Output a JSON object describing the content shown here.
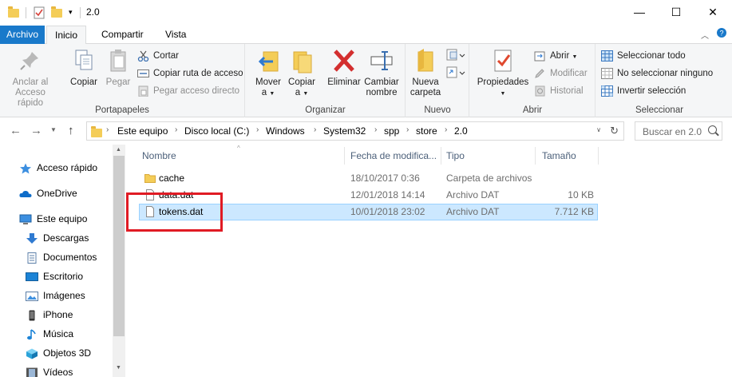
{
  "window": {
    "title": "2.0",
    "controls": {
      "minimize": "—",
      "maximize": "☐",
      "close": "✕"
    }
  },
  "ribbon_tabs": [
    {
      "label": "Archivo"
    },
    {
      "label": "Inicio"
    },
    {
      "label": "Compartir"
    },
    {
      "label": "Vista"
    }
  ],
  "ribbon": {
    "portapapeles": {
      "label": "Portapapeles",
      "pin": "Anclar al\nAcceso rápido",
      "pin_l1": "Anclar al",
      "pin_l2": "Acceso rápido",
      "copy": "Copiar",
      "paste": "Pegar",
      "cut": "Cortar",
      "copy_path": "Copiar ruta de acceso",
      "paste_shortcut": "Pegar acceso directo"
    },
    "organizar": {
      "label": "Organizar",
      "move_l1": "Mover",
      "move_l2": "a",
      "copy_l1": "Copiar",
      "copy_l2": "a",
      "delete": "Eliminar",
      "rename_l1": "Cambiar",
      "rename_l2": "nombre"
    },
    "nuevo": {
      "label": "Nuevo",
      "new_folder_l1": "Nueva",
      "new_folder_l2": "carpeta"
    },
    "abrir": {
      "label": "Abrir",
      "properties": "Propiedades",
      "open": "Abrir",
      "edit": "Modificar",
      "history": "Historial"
    },
    "seleccionar": {
      "label": "Seleccionar",
      "select_all": "Seleccionar todo",
      "select_none": "No seleccionar ninguno",
      "invert": "Invertir selección"
    }
  },
  "address": {
    "crumbs": [
      "Este equipo",
      "Disco local (C:)",
      "Windows",
      "System32",
      "spp",
      "store",
      "2.0"
    ],
    "search_placeholder": "Buscar en 2.0"
  },
  "nav_pane": {
    "items": [
      {
        "label": "Acceso rápido",
        "icon": "star-icon"
      },
      {
        "label": "OneDrive",
        "icon": "cloud-icon"
      },
      {
        "label": "Este equipo",
        "icon": "computer-icon"
      },
      {
        "label": "Descargas",
        "icon": "download-arrow-icon"
      },
      {
        "label": "Documentos",
        "icon": "document-icon"
      },
      {
        "label": "Escritorio",
        "icon": "desktop-icon"
      },
      {
        "label": "Imágenes",
        "icon": "pictures-icon"
      },
      {
        "label": "iPhone",
        "icon": "phone-icon"
      },
      {
        "label": "Música",
        "icon": "music-note-icon"
      },
      {
        "label": "Objetos 3D",
        "icon": "cube-icon"
      },
      {
        "label": "Vídeos",
        "icon": "film-icon"
      }
    ]
  },
  "file_list": {
    "columns": [
      "Nombre",
      "Fecha de modifica...",
      "Tipo",
      "Tamaño"
    ],
    "rows": [
      {
        "name": "cache",
        "date": "18/10/2017 0:36",
        "type": "Carpeta de archivos",
        "size": "",
        "icon": "folder-icon",
        "selected": false
      },
      {
        "name": "data.dat",
        "date": "12/01/2018 14:14",
        "type": "Archivo DAT",
        "size": "10 KB",
        "icon": "file-icon",
        "selected": false
      },
      {
        "name": "tokens.dat",
        "date": "10/01/2018 23:02",
        "type": "Archivo DAT",
        "size": "7.712 KB",
        "icon": "file-icon",
        "selected": true
      }
    ]
  },
  "colors": {
    "file_tab": "#1979ca",
    "selection": "#cce8ff",
    "highlight_box": "#e01b24",
    "folder": "#f4cd58"
  }
}
